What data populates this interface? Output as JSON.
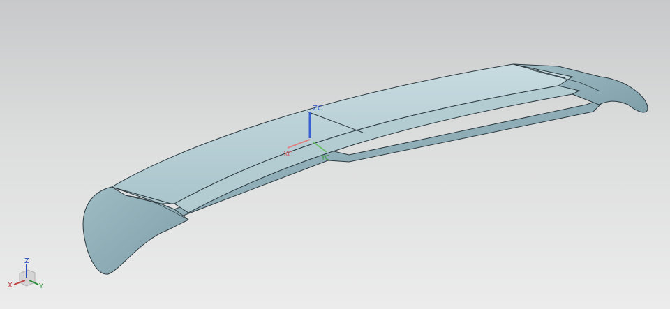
{
  "viewport": {
    "wcs_labels": {
      "z": "ZC",
      "x": "XC",
      "y": "YC"
    },
    "triad_labels": {
      "z": "Z",
      "x": "X",
      "y": "Y"
    }
  },
  "colors": {
    "model": "#b9d2d8",
    "edge": "#2c3a40",
    "x_axis": "#d06060",
    "y_axis": "#3fa048",
    "z_axis": "#3a5fd0"
  }
}
